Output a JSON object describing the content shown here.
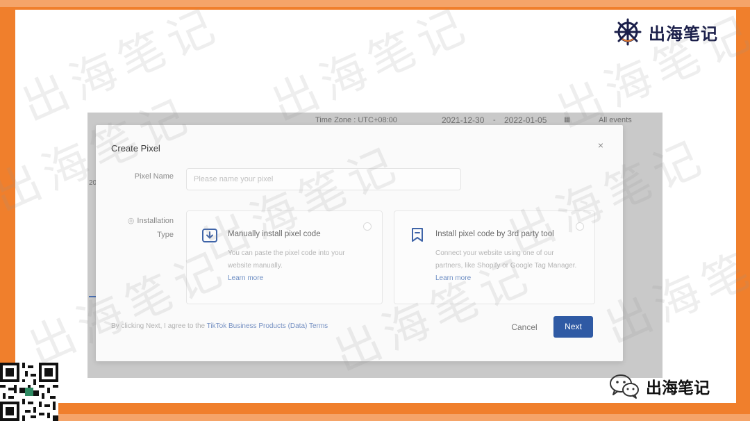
{
  "brand": {
    "name": "出海笔记"
  },
  "watermark": {
    "text": "出海笔记"
  },
  "background_app": {
    "time_zone": "Time Zone : UTC+08:00",
    "date_start": "2021-12-30",
    "date_separator": "-",
    "date_end": "2022-01-05",
    "events_filter": "All events",
    "side_text": "20"
  },
  "modal": {
    "title": "Create Pixel",
    "close_symbol": "×",
    "pixel_name": {
      "label": "Pixel Name",
      "placeholder": "Please name your pixel",
      "value": ""
    },
    "installation_type": {
      "required_mark": "◎",
      "label_line1": "Installation",
      "label_line2": "Type"
    },
    "options": [
      {
        "icon": "download-code-icon",
        "title": "Manually install pixel code",
        "description": "You can paste the pixel code into your website manually.",
        "link": "Learn more"
      },
      {
        "icon": "bookmark-icon",
        "title": "Install pixel code by 3rd party tool",
        "description": "Connect your website using one of our partners, like Shopify or Google Tag Manager.",
        "link": "Learn more"
      }
    ],
    "terms_prefix": "By clicking Next, I agree to the ",
    "terms_link": "TikTok Business Products (Data) Terms",
    "cancel_label": "Cancel",
    "next_label": "Next"
  },
  "colors": {
    "frame_orange": "#f07f2c",
    "primary_button": "#2f5aa4",
    "link_blue": "#7590c2"
  },
  "footer": {
    "wechat_account": "出海笔记"
  }
}
